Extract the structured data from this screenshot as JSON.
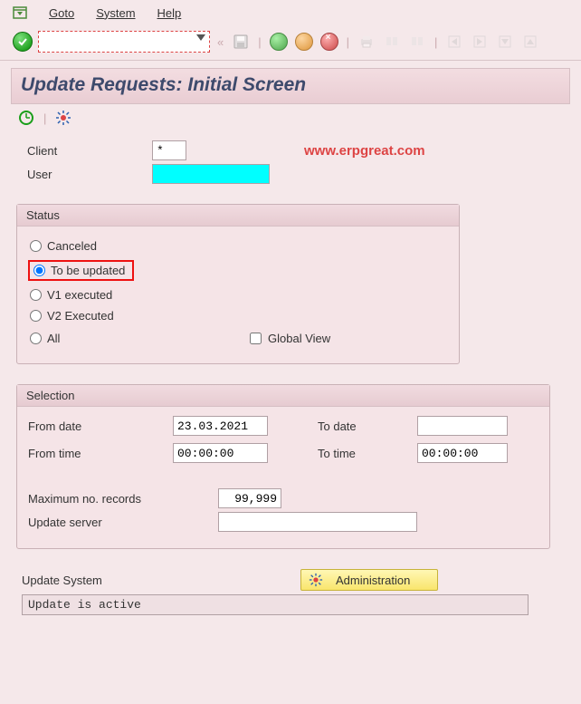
{
  "menu": {
    "items": [
      "Goto",
      "System",
      "Help"
    ]
  },
  "title": "Update Requests: Initial Screen",
  "watermark": "www.erpgreat.com",
  "header_fields": {
    "client_label": "Client",
    "client_value": "*",
    "user_label": "User",
    "user_value": ""
  },
  "status_box": {
    "title": "Status",
    "options": {
      "canceled": "Canceled",
      "to_be_updated": "To be updated",
      "v1": "V1 executed",
      "v2": "V2 Executed",
      "all": "All"
    },
    "selected": "to_be_updated",
    "global_view_label": "Global View",
    "global_view_checked": false
  },
  "selection_box": {
    "title": "Selection",
    "from_date_label": "From date",
    "from_date": "23.03.2021",
    "to_date_label": "To date",
    "to_date": "",
    "from_time_label": "From time",
    "from_time": "00:00:00",
    "to_time_label": "To time",
    "to_time": "00:00:00",
    "max_records_label": "Maximum no. records",
    "max_records": "99,999",
    "update_server_label": "Update server",
    "update_server": ""
  },
  "update_system": {
    "label": "Update System",
    "button": "Administration",
    "status": "Update is active"
  }
}
